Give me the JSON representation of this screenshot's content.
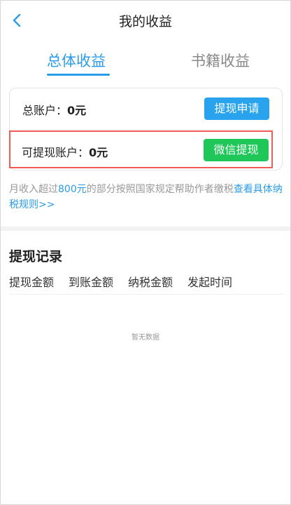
{
  "header": {
    "title": "我的收益",
    "back_icon": "chevron-left-icon",
    "back_color": "#2b9ce8"
  },
  "tabs": [
    {
      "label": "总体收益",
      "active": true
    },
    {
      "label": "书籍收益",
      "active": false
    }
  ],
  "account": {
    "total": {
      "label": "总账户：",
      "value": "0元",
      "button": "提现申请"
    },
    "withdrawable": {
      "label": "可提现账户：",
      "value": "0元",
      "button": "微信提现"
    }
  },
  "tax_note": {
    "prefix": "月收入超过",
    "threshold": "800元",
    "middle": "的部分按照国家规定帮助作者缴税",
    "link": "查看具体纳税规则>>"
  },
  "records": {
    "title": "提现记录",
    "columns": [
      "提现金额",
      "到账金额",
      "纳税金额",
      "发起时间"
    ],
    "empty_text": "暂无数据"
  },
  "colors": {
    "accent": "#2b9ce8",
    "apply_button": "#29a3ee",
    "wechat_button": "#1fc759",
    "highlight_border": "#f15a55"
  }
}
